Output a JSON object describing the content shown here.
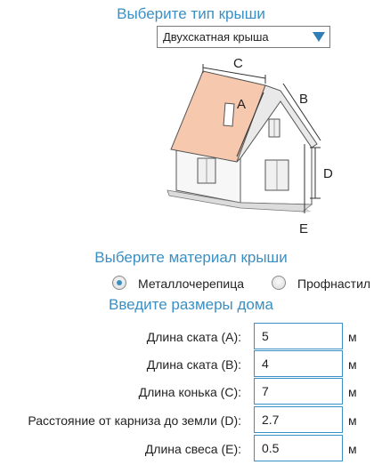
{
  "roof_type": {
    "title": "Выберите тип крыши",
    "selected": "Двухскатная крыша"
  },
  "diagram": {
    "labels": {
      "a": "A",
      "b": "B",
      "c": "C",
      "d": "D",
      "e": "E"
    },
    "colors": {
      "roof": "#f6c8ad",
      "wall": "#ffffff",
      "line": "#444444"
    }
  },
  "material": {
    "title": "Выберите материал крыши",
    "options": [
      {
        "label": "Металлочерепица",
        "checked": true
      },
      {
        "label": "Профнастил",
        "checked": false
      }
    ]
  },
  "dimensions": {
    "title": "Введите размеры дома",
    "fields": [
      {
        "label": "Длина ската (A):",
        "value": "5",
        "unit": "м"
      },
      {
        "label": "Длина ската (B):",
        "value": "4",
        "unit": "м"
      },
      {
        "label": "Длина конька (C):",
        "value": "7",
        "unit": "м"
      },
      {
        "label": "Расстояние от карниза до земли (D):",
        "value": "2.7",
        "unit": "м"
      },
      {
        "label": "Длина свеса (E):",
        "value": "0.5",
        "unit": "м"
      }
    ]
  },
  "accent_color": "#3a8fc4"
}
